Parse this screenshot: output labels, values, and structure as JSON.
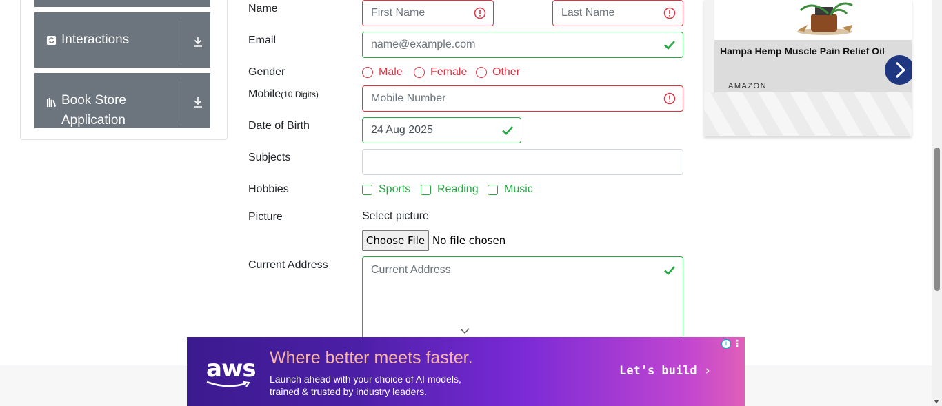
{
  "sidebar": {
    "groups": [
      {
        "label": "Interactions",
        "icon": "refresh-icon"
      },
      {
        "label_line1": "Book Store",
        "label_line2": "Application",
        "icon": "books-icon"
      }
    ]
  },
  "form": {
    "name_label": "Name",
    "first_name_placeholder": "First Name",
    "last_name_placeholder": "Last Name",
    "email_label": "Email",
    "email_placeholder": "name@example.com",
    "gender_label": "Gender",
    "gender_options": [
      "Male",
      "Female",
      "Other"
    ],
    "mobile_label": "Mobile",
    "mobile_hint": "(10 Digits)",
    "mobile_placeholder": "Mobile Number",
    "dob_label": "Date of Birth",
    "dob_value": "24 Aug 2025",
    "subjects_label": "Subjects",
    "hobbies_label": "Hobbies",
    "hobby_options": [
      "Sports",
      "Reading",
      "Music"
    ],
    "picture_label": "Picture",
    "select_picture": "Select picture",
    "choose_file": "Choose File",
    "no_file": "No file chosen",
    "address_label": "Current Address",
    "address_placeholder": "Current Address"
  },
  "ad_right": {
    "title": "Hampa Hemp Muscle Pain Relief Oil",
    "brand": "AMAZON"
  },
  "ad_bottom": {
    "logo": "aws",
    "headline": "Where better meets faster.",
    "sub_line1": "Launch ahead with your choice of AI models,",
    "sub_line2": "trained & trusted by industry leaders.",
    "cta": "Let’s build ›"
  },
  "colors": {
    "invalid": "#dc3545",
    "valid": "#28a745",
    "sidebar": "#6c757d"
  }
}
